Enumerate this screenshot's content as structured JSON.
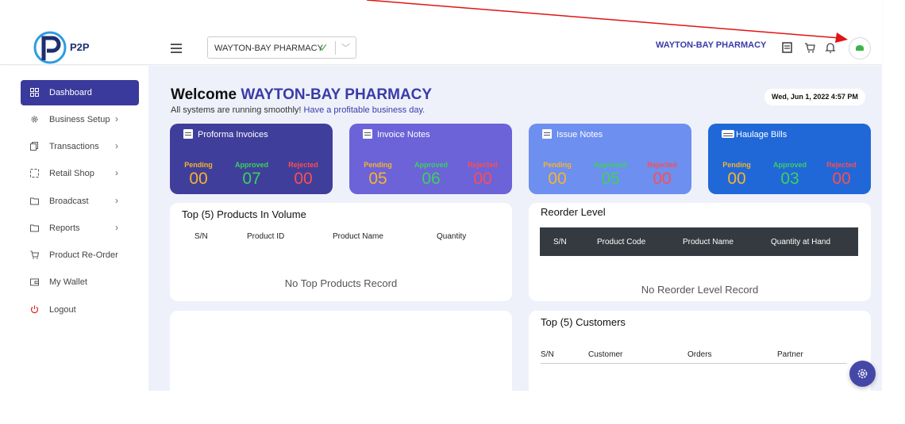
{
  "header": {
    "logo_text": "P2P",
    "branch_select": {
      "value": "WAYTON-BAY PHARMACY"
    },
    "company_name": "WAYTON-BAY PHARMACY"
  },
  "sidebar": {
    "items": [
      {
        "label": "Dashboard",
        "icon": "grid-icon",
        "active": true
      },
      {
        "label": "Business Setup",
        "icon": "gear-icon"
      },
      {
        "label": "Transactions",
        "icon": "copy-icon"
      },
      {
        "label": "Retail Shop",
        "icon": "bracket-icon"
      },
      {
        "label": "Broadcast",
        "icon": "folder-icon"
      },
      {
        "label": "Reports",
        "icon": "folder-icon"
      },
      {
        "label": "Product Re-Order",
        "icon": "cart-icon"
      },
      {
        "label": "My Wallet",
        "icon": "wallet-icon"
      },
      {
        "label": "Logout",
        "icon": "power-icon"
      }
    ]
  },
  "welcome": {
    "prefix": "Welcome",
    "company": "WAYTON-BAY PHARMACY",
    "subtitle_start": "All systems are running smoothly!",
    "subtitle_highlight": "Have a profitable business day.",
    "datetime": "Wed, Jun 1, 2022 4:57 PM"
  },
  "cards": [
    {
      "title": "Proforma Invoices",
      "bg": "#3f3f9b",
      "pending": "00",
      "approved": "07",
      "rejected": "00"
    },
    {
      "title": "Invoice Notes",
      "bg": "#6c63d9",
      "pending": "05",
      "approved": "06",
      "rejected": "00"
    },
    {
      "title": "Issue Notes",
      "bg": "#6d8ff0",
      "pending": "00",
      "approved": "05",
      "rejected": "00"
    },
    {
      "title": "Haulage Bills",
      "bg": "#2068d8",
      "pending": "00",
      "approved": "03",
      "rejected": "00"
    }
  ],
  "stat_labels": {
    "pending": "Pending",
    "approved": "Approved",
    "rejected": "Rejected"
  },
  "colors": {
    "pending": "#f7b32b",
    "approved": "#3bd25a",
    "rejected": "#ff4d4d",
    "accent": "#3a3ba8"
  },
  "top_products": {
    "title": "Top (5) Products In Volume",
    "columns": [
      "S/N",
      "Product ID",
      "Product Name",
      "Quantity"
    ],
    "empty": "No Top Products Record"
  },
  "reorder": {
    "title": "Reorder Level",
    "columns": [
      "S/N",
      "Product Code",
      "Product Name",
      "Quantity at Hand"
    ],
    "empty": "No Reorder Level Record"
  },
  "top_customers": {
    "title": "Top (5) Customers",
    "columns": [
      "S/N",
      "Customer",
      "Orders",
      "Partner"
    ]
  }
}
